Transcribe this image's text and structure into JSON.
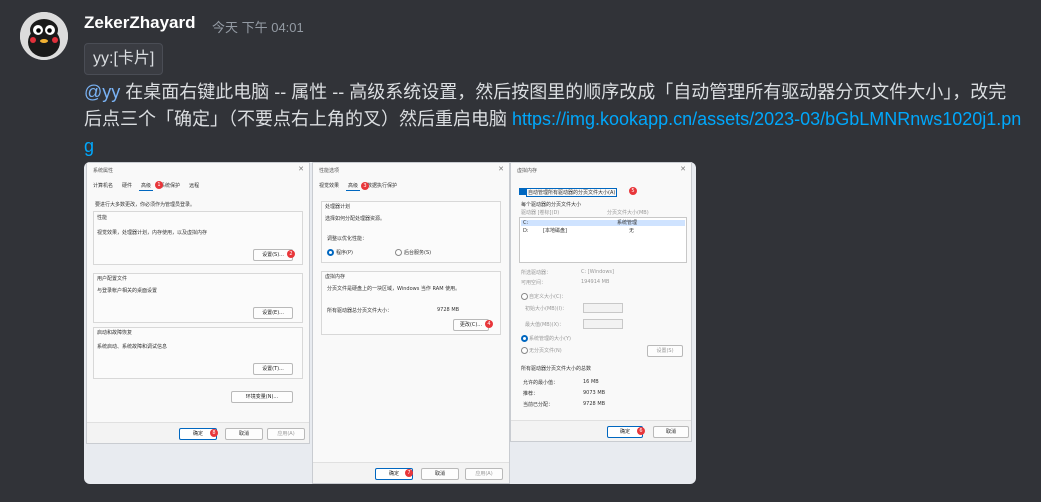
{
  "message": {
    "username": "ZekerZhayard",
    "timestamp": "今天 下午 04:01",
    "card_tag": "yy:[卡片]",
    "mention": "@yy",
    "text": " 在桌面右键此电脑 -- 属性 -- 高级系统设置，然后按图里的顺序改成「自动管理所有驱动器分页文件大小」，改完后点三个「确定」（不要点右上角的叉）然后重启电脑 ",
    "link": "https://img.kookapp.cn/assets/2023-03/bGbLMNRnws1020j1.png"
  },
  "screenshot": {
    "win1": {
      "title": "系统属性",
      "tabs": [
        "计算机名",
        "硬件",
        "高级",
        "系统保护",
        "远程"
      ],
      "active_tab": 2,
      "admin_note": "要进行大多数更改，你必须作为管理员登录。",
      "perf_title": "性能",
      "perf_desc": "视觉效果，处理器计划，内存使用，以及虚拟内存",
      "settings_btn": "设置(S)...",
      "profile_title": "用户配置文件",
      "profile_desc": "与登录帐户相关的桌面设置",
      "profile_btn": "设置(E)...",
      "startup_title": "启动和故障恢复",
      "startup_desc": "系统启动、系统故障和调试信息",
      "startup_btn": "设置(T)...",
      "env_btn": "环境变量(N)...",
      "ok": "确定",
      "cancel": "取消",
      "apply": "应用(A)",
      "badges": [
        "1",
        "2",
        "8"
      ]
    },
    "win2": {
      "title": "性能选项",
      "tabs": [
        "视觉效果",
        "高级",
        "数据执行保护"
      ],
      "active_tab": 1,
      "proc_title": "处理器计划",
      "proc_desc": "选择如何分配处理器资源。",
      "adjust_label": "调整以优化性能：",
      "opt_programs": "程序(P)",
      "opt_services": "后台服务(S)",
      "vm_title": "虚拟内存",
      "vm_desc": "分页文件是硬盘上的一块区域，Windows 当作 RAM 使用。",
      "vm_total_label": "所有驱动器总分页文件大小：",
      "vm_total_value": "9728 MB",
      "change_btn": "更改(C)...",
      "ok": "确定",
      "cancel": "取消",
      "apply": "应用(A)",
      "badges": [
        "3",
        "4",
        "7"
      ]
    },
    "win3": {
      "title": "虚拟内存",
      "auto_manage": "自动管理所有驱动器的分页文件大小(A)",
      "per_drive_title": "每个驱动器的分页文件大小",
      "col_drive": "驱动器 [卷标](D)",
      "col_size": "分页文件大小(MB)",
      "rows": [
        {
          "drive": "C:",
          "label": "",
          "size": "系统管理"
        },
        {
          "drive": "D:",
          "label": "[本地磁盘]",
          "size": "无"
        }
      ],
      "selected_drive_label": "所选驱动器：",
      "selected_drive_value": "C: [Windows]",
      "space_label": "可用空间：",
      "space_value": "194914 MB",
      "custom_size": "自定义大小(C)：",
      "initial_size": "初始大小(MB)(I)：",
      "max_size": "最大值(MB)(X)：",
      "system_managed": "系统管理的大小(Y)",
      "no_paging": "无分页文件(N)",
      "set_btn": "设置(S)",
      "total_title": "所有驱动器分页文件大小的总数",
      "min_label": "允许的最小值：",
      "min_value": "16 MB",
      "rec_label": "推荐：",
      "rec_value": "9073 MB",
      "cur_label": "当前已分配：",
      "cur_value": "9728 MB",
      "ok": "确定",
      "cancel": "取消",
      "badges": [
        "5",
        "6"
      ]
    }
  },
  "colors": {
    "background": "#313338",
    "link": "#00a8fc",
    "mention": "#7ab3f5",
    "badge": "#e8363a"
  }
}
